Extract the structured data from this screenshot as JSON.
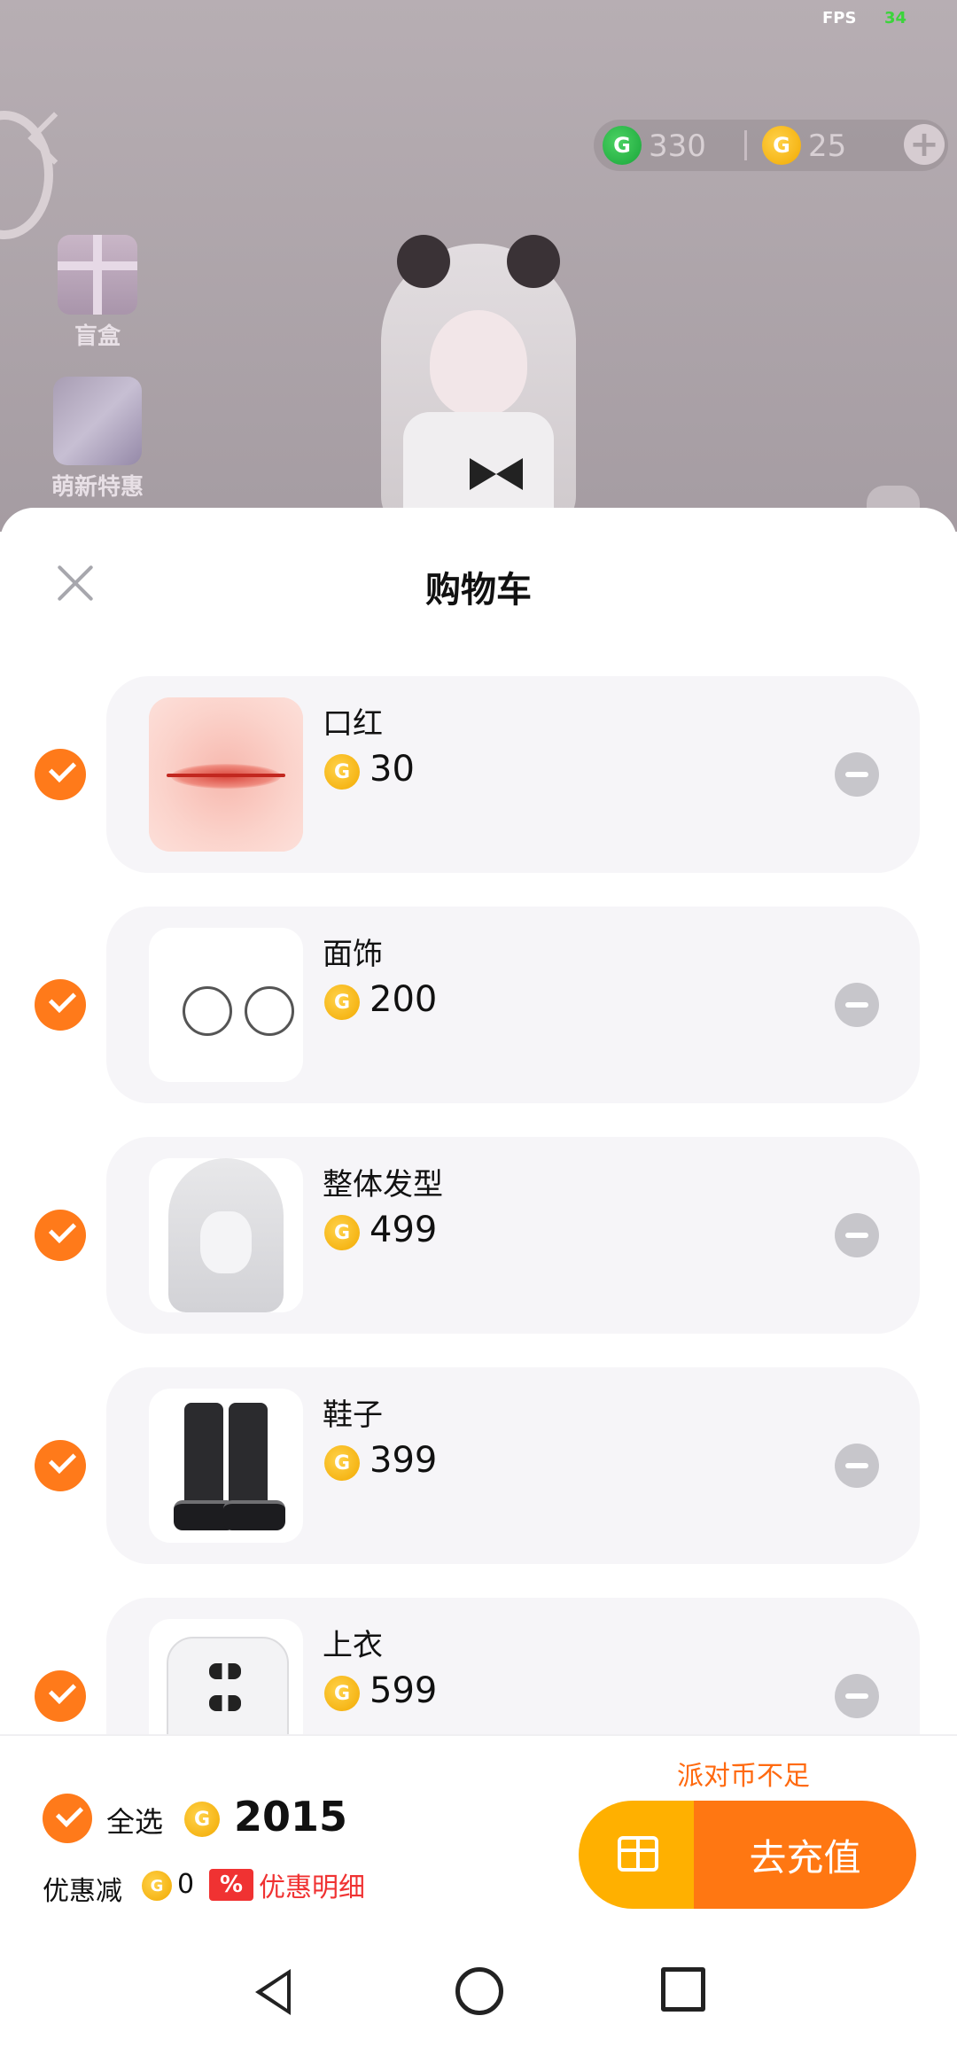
{
  "status": {
    "fps_label": "FPS",
    "fps_value": "34"
  },
  "currency": {
    "green_amount": "330",
    "gold_amount": "25",
    "add_icon": "plus-icon"
  },
  "side": {
    "blind_box_label": "盲盒",
    "newbie_label": "萌新特惠"
  },
  "sheet": {
    "title": "购物车"
  },
  "items": [
    {
      "name": "口红",
      "price": "30"
    },
    {
      "name": "面饰",
      "price": "200"
    },
    {
      "name": "整体发型",
      "price": "499"
    },
    {
      "name": "鞋子",
      "price": "399"
    },
    {
      "name": "上衣",
      "price": "599"
    }
  ],
  "footer": {
    "select_all": "全选",
    "total": "2015",
    "discount_label": "优惠减",
    "discount_value": "0",
    "discount_badge": "%",
    "discount_detail": "优惠明细",
    "insufficient": "派对币不足",
    "recharge": "去充值"
  },
  "colors": {
    "accent": "#ff7a1a",
    "accent_dark": "#ff7712",
    "gold": "#ffb000",
    "red": "#f03232"
  }
}
